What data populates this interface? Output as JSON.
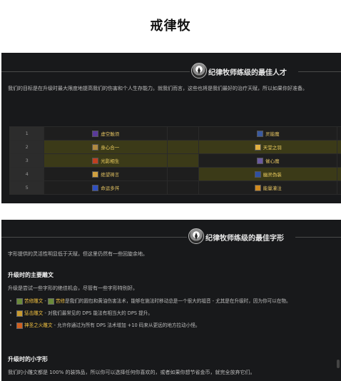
{
  "page_title": "戒律牧",
  "talent_section": {
    "title": "纪律牧师练级的最佳人才",
    "description": "我们的目标是在升级时最大限度地提高我们的伤害和个人生存能力。就我们而言，这些也将是我们最好的治疗天赋，所以如果你好准备。",
    "rows": [
      {
        "level": "1",
        "left": "虚空触须",
        "mid": "",
        "right": "灵能魔",
        "pick": "none"
      },
      {
        "level": "2",
        "left": "身心合一",
        "mid": "",
        "right": "天堂之羽",
        "pick": "both"
      },
      {
        "level": "3",
        "left": "光影相生",
        "mid": "",
        "right": "催心魔",
        "pick": "left"
      },
      {
        "level": "4",
        "left": "绝望祷言",
        "mid": "",
        "right": "幽灵伪装",
        "pick": "right"
      },
      {
        "level": "5",
        "left": "命运多舛",
        "mid": "",
        "right": "能量灌注",
        "pick": "none"
      }
    ]
  },
  "glyph_section": {
    "title": "纪律牧师练级的最佳字形",
    "description": "字形提供的灵活性明显低于天赋，但这里仍然有一些回旋余地。",
    "major_heading": "升级时的主要雕文",
    "major_desc": "升级是尝试一些字形的绝佳机会，尽管有一些字形特别好。",
    "major_items": [
      {
        "name": "苦修雕文",
        "sep": " - ",
        "name2": "苦修",
        "text": "是我们的圆包和黄油伤害法术，能够在施法时移动总是一个很大的福音 - 尤其是在升级时，因为你可以在物。"
      },
      {
        "name": "惩击雕文",
        "sep": " - ",
        "name2": "",
        "text": "对我们最常见的 DPS 能法有相当大的 DPS 提升。"
      },
      {
        "name": "神圣之火雕文",
        "sep": " - ",
        "name2": "",
        "text": "允许你通过为所有 DPS 法术增加 +10 码来从更远的地方拉动小怪。"
      }
    ],
    "minor_heading": "升级时的小字形",
    "minor_desc": "我们的小雕文都是 100% 的装饰品，所以你可以选择任何你喜欢的，或者如果你想节省金币，就完全放弃它们。"
  },
  "colors": {
    "panel_bg": "#18191b",
    "highlight": "#3b3a18",
    "glyph_name": "#f0c040"
  }
}
